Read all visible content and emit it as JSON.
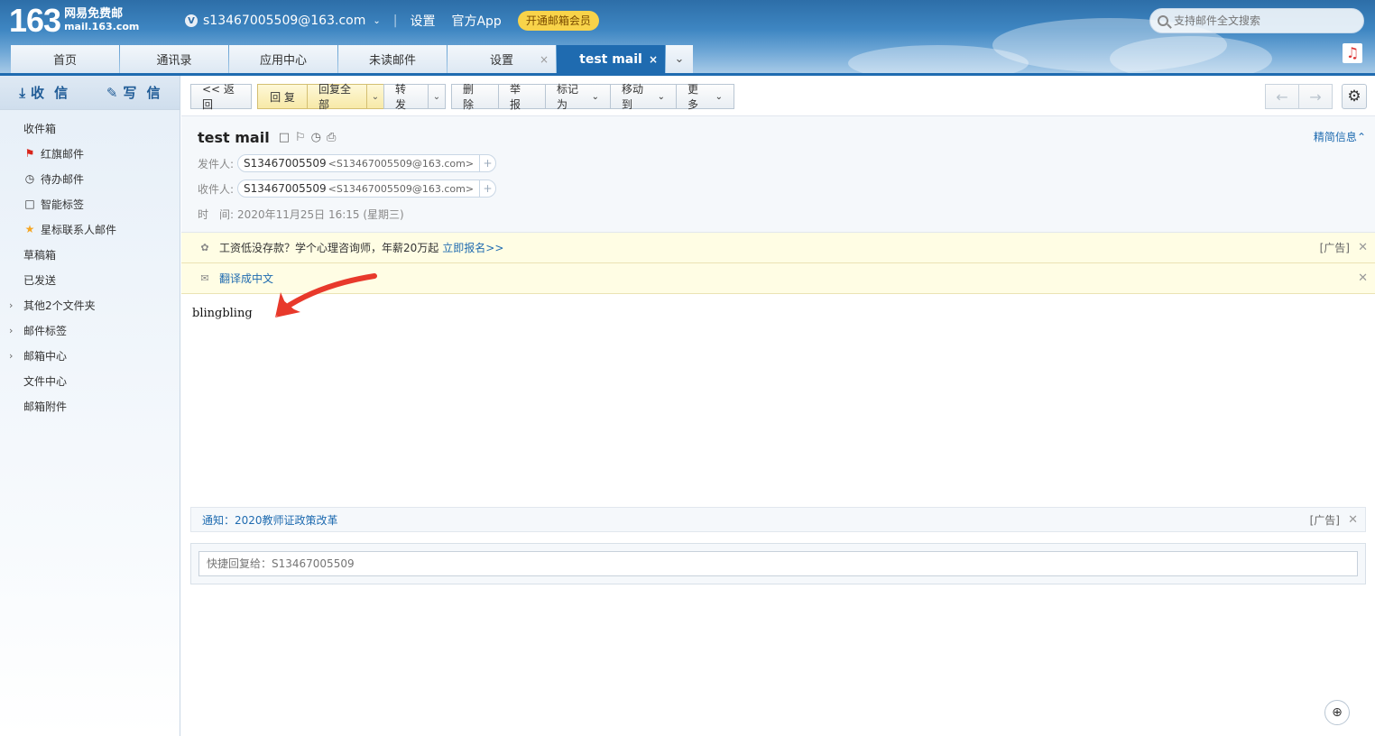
{
  "header": {
    "logo_number": "163",
    "logo_cn": "网易免费邮",
    "logo_en": "mail.163.com",
    "vip_badge": "V",
    "account": "s13467005509@163.com",
    "settings_link": "设置",
    "app_link": "官方App",
    "vip_button": "开通邮箱会员",
    "search_placeholder": "支持邮件全文搜索"
  },
  "tabs": [
    {
      "label": "首页"
    },
    {
      "label": "通讯录"
    },
    {
      "label": "应用中心"
    },
    {
      "label": "未读邮件"
    },
    {
      "label": "设置",
      "close": "×"
    },
    {
      "label": "test mail",
      "close": "×"
    }
  ],
  "sidebar": {
    "receive": "收 信",
    "write": "写 信",
    "items": [
      {
        "label": "收件箱"
      },
      {
        "label": "红旗邮件"
      },
      {
        "label": "待办邮件"
      },
      {
        "label": "智能标签"
      },
      {
        "label": "星标联系人邮件"
      },
      {
        "label": "草稿箱"
      },
      {
        "label": "已发送"
      },
      {
        "label": "其他2个文件夹"
      },
      {
        "label": "邮件标签"
      },
      {
        "label": "邮箱中心"
      },
      {
        "label": "文件中心"
      },
      {
        "label": "邮箱附件"
      }
    ]
  },
  "toolbar": {
    "back": "<< 返回",
    "reply": "回 复",
    "reply_all": "回复全部",
    "forward": "转 发",
    "delete": "删 除",
    "report": "举 报",
    "mark_as": "标记为",
    "move_to": "移动到",
    "more": "更 多"
  },
  "mail": {
    "subject": "test mail",
    "brief_info": "精简信息",
    "from_label": "发件人:",
    "from_name": "S13467005509",
    "from_email": "<S13467005509@163.com>",
    "to_label": "收件人:",
    "to_name": "S13467005509",
    "to_email": "<S13467005509@163.com>",
    "time_label": "时　间:",
    "time_value": "2020年11月25日 16:15 (星期三)",
    "body": "blingbling"
  },
  "ads": {
    "top_text": "工资低没存款？学个心理咨询师，年薪20万起",
    "top_link": "立即报名>>",
    "ad_tag": "[广告]",
    "translate": "翻译成中文",
    "notice": "通知：2020教师证政策改革"
  },
  "quick_reply_placeholder": "快捷回复给：S13467005509",
  "colors": {
    "brand_blue": "#1f6bb0",
    "vip_yellow": "#f8d34a",
    "ad_bg": "#fffde4",
    "arrow_red": "#e8392b"
  }
}
